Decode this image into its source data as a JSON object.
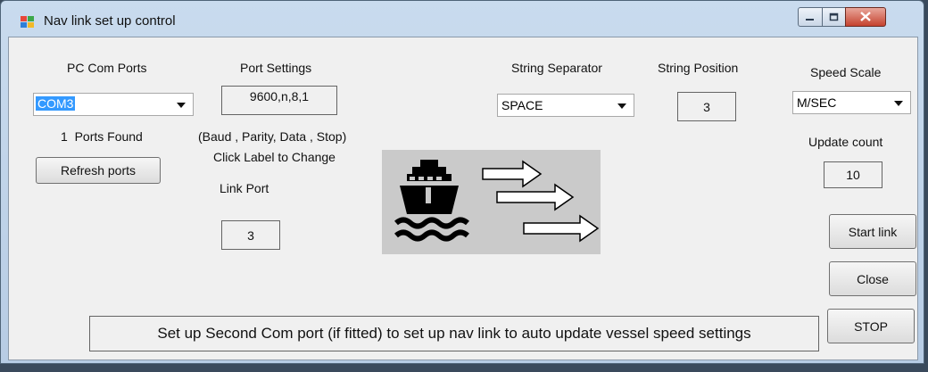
{
  "window": {
    "title": "Nav link set up control"
  },
  "com_ports": {
    "heading": "PC Com Ports",
    "selected": "COM3",
    "found_count": "1",
    "found_label": "Ports Found",
    "refresh_label": "Refresh ports"
  },
  "port_settings": {
    "heading": "Port Settings",
    "value": "9600,n,8,1",
    "format_hint": "(Baud , Parity, Data , Stop)",
    "click_hint": "Click Label to Change",
    "link_port_label": "Link Port",
    "link_port_value": "3"
  },
  "string_separator": {
    "heading": "String Separator",
    "selected": "SPACE"
  },
  "string_position": {
    "heading": "String Position",
    "value": "3"
  },
  "speed_scale": {
    "heading": "Speed Scale",
    "selected": "M/SEC"
  },
  "update_count": {
    "heading": "Update count",
    "value": "10"
  },
  "buttons": {
    "start_link": "Start link",
    "close": "Close",
    "stop": "STOP"
  },
  "footer_message": "Set up Second Com port (if fitted) to set up nav link to auto update vessel speed settings",
  "icons": {
    "graphic": "ship-icon",
    "arrows": "arrow-right-icon",
    "app": "windows-form-icon"
  }
}
